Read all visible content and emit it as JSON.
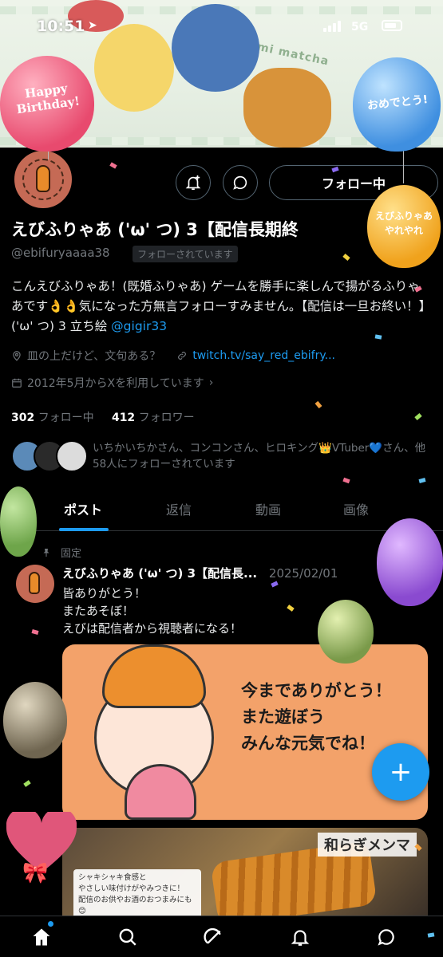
{
  "status_bar": {
    "time": "10:51",
    "network": "5G"
  },
  "banner": {
    "watermark": "nomi matcha"
  },
  "balloons": {
    "happy_birthday": "Happy Birthday!",
    "omedetou": "おめでとう!",
    "yareyare": "えびふりゃあ やれやれ"
  },
  "profile": {
    "follow_button": "フォロー中",
    "display_name": "えびふりゃあ ('ω' つ) 3【配信長期終",
    "handle": "@ebifuryaaaa38",
    "follows_you": "フォローされています",
    "bio_text": "こんえびふりゃあ！(既婚ふりゃあ) ゲームを勝手に楽しんで揚がるふりゃあです👌👌気になった方無言フォローすみません。【配信は一旦お終い！】('ω' つ) 3 立ち絵 ",
    "bio_link": "@gigir33",
    "location": "皿の上だけど、文句ある？",
    "website": "twitch.tv/say_red_ebifry...",
    "joined": "2012年5月からXを利用しています",
    "following_count": "302",
    "following_label": "フォロー中",
    "followers_count": "412",
    "followers_label": "フォロワー",
    "followed_by": "いちかいちかさん、コンコンさん、ヒロキング👑VTuber💙さん、他58人にフォローされています"
  },
  "tabs": [
    {
      "label": "ポスト",
      "active": true
    },
    {
      "label": "返信",
      "active": false
    },
    {
      "label": "動画",
      "active": false
    },
    {
      "label": "画像",
      "active": false
    }
  ],
  "pinned_post": {
    "pinned_label": "固定",
    "author": "えびふりゃあ ('ω' つ) 3【配信長...",
    "date": "2025/02/01",
    "lines": [
      "皆ありがとう！",
      "またあそぼ！",
      "えびは配信者から視聴者になる！"
    ],
    "image_text_lines": [
      "今までありがとう！",
      "また遊ぼう",
      "みんな元気でね！"
    ]
  },
  "second_post_image": {
    "title": "和らぎメンマ",
    "caption_lines": [
      "シャキシャキ食感と",
      "やさしい味付けがやみつきに！",
      "配信のお供やお酒のおつまみにも😊"
    ]
  },
  "fab": {
    "label": "+"
  },
  "colors": {
    "accent": "#1d9bf0",
    "background": "#000000",
    "muted": "#71767b"
  },
  "icons": {
    "notification_bell": "bell-plus-icon",
    "message": "message-icon",
    "location": "location-pin-icon",
    "link": "link-icon",
    "calendar": "calendar-icon",
    "pin": "pin-icon",
    "nav": [
      "home-icon",
      "search-icon",
      "grok-icon",
      "notifications-icon",
      "messages-icon"
    ]
  }
}
